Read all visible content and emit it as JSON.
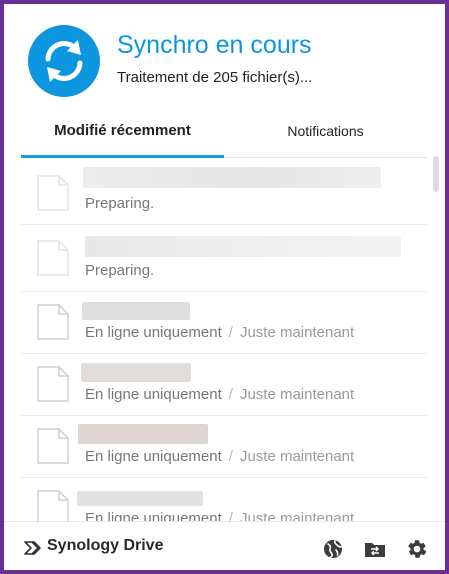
{
  "header": {
    "title": "Synchro en cours",
    "subtitle": "Traitement de 205 fichier(s)..."
  },
  "tabs": {
    "recent": "Modifié récemment",
    "notifications": "Notifications",
    "active": "recent"
  },
  "items": [
    {
      "status": "Preparing.",
      "time": ""
    },
    {
      "status": "Preparing.",
      "time": ""
    },
    {
      "status": "En ligne uniquement",
      "separator": "/",
      "time": "Juste maintenant"
    },
    {
      "status": "En ligne uniquement",
      "separator": "/",
      "time": "Juste maintenant"
    },
    {
      "status": "En ligne uniquement",
      "separator": "/",
      "time": "Juste maintenant"
    },
    {
      "status": "En ligne uniquement",
      "separator": "/",
      "time": "Juste maintenant"
    }
  ],
  "footer": {
    "brand": "Synology Drive",
    "icons": [
      "globe-icon",
      "folder-sync-icon",
      "gear-icon"
    ]
  },
  "colors": {
    "accent": "#0d96e0",
    "frame": "#6a2d91",
    "tab_underline": "#14a0df"
  }
}
